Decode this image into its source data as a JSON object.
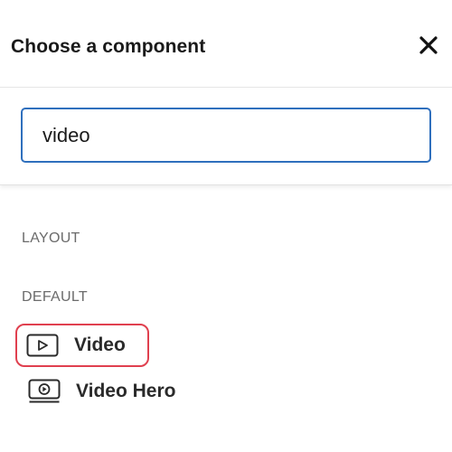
{
  "dialog": {
    "title": "Choose a component",
    "close_icon": "close-icon"
  },
  "search": {
    "value": "video",
    "placeholder": ""
  },
  "sections": [
    {
      "label": "LAYOUT",
      "items": []
    },
    {
      "label": "DEFAULT",
      "items": [
        {
          "label": "Video",
          "icon": "video-play-icon",
          "highlighted": true
        },
        {
          "label": "Video Hero",
          "icon": "video-hero-icon",
          "highlighted": false
        }
      ]
    }
  ],
  "colors": {
    "focus_border": "#2f6fbd",
    "highlight_border": "#e0404f",
    "section_label": "#6b6b6b"
  }
}
